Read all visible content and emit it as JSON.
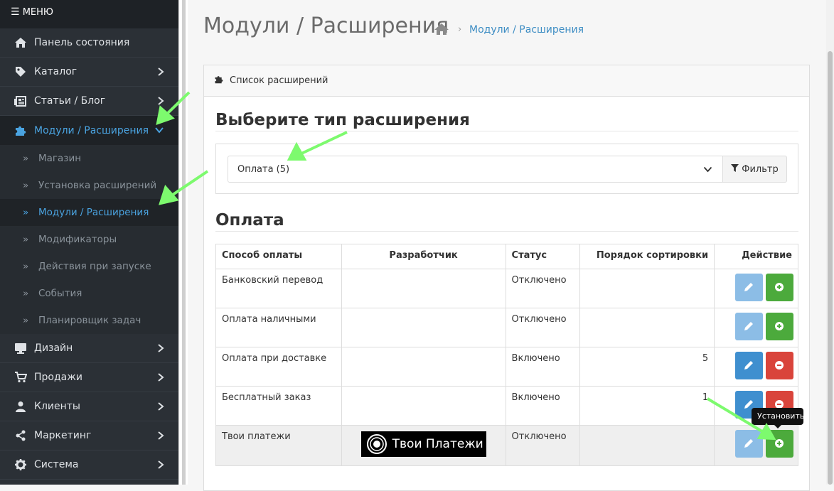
{
  "sidebar": {
    "menu_label": "МЕНЮ",
    "items": [
      {
        "label": "Панель состояния",
        "icon": "home-icon"
      },
      {
        "label": "Каталог",
        "icon": "tag-icon"
      },
      {
        "label": "Статьи / Блог",
        "icon": "newspaper-icon"
      },
      {
        "label": "Модули / Расширения",
        "icon": "puzzle-icon"
      },
      {
        "label": "Дизайн",
        "icon": "desktop-icon"
      },
      {
        "label": "Продажи",
        "icon": "cart-icon"
      },
      {
        "label": "Клиенты",
        "icon": "user-icon"
      },
      {
        "label": "Маркетинг",
        "icon": "share-icon"
      },
      {
        "label": "Система",
        "icon": "gear-icon"
      }
    ],
    "submenu": [
      {
        "label": "Магазин"
      },
      {
        "label": "Установка расширений"
      },
      {
        "label": "Модули / Расширения"
      },
      {
        "label": "Модификаторы"
      },
      {
        "label": "Действия при запуске"
      },
      {
        "label": "События"
      },
      {
        "label": "Планировщик задач"
      }
    ]
  },
  "header": {
    "title": "Модули / Расширения",
    "breadcrumb": "Модули / Расширения"
  },
  "panel": {
    "heading": "Список расширений",
    "choose_type": "Выберите тип расширения",
    "select_value": "Оплата (5)",
    "filter_label": "Фильтр",
    "section_title": "Оплата"
  },
  "table": {
    "columns": [
      "Способ оплаты",
      "Разработчик",
      "Статус",
      "Порядок сортировки",
      "Действие"
    ],
    "rows": [
      {
        "name": "Банковский перевод",
        "developer": "",
        "status": "Отключено",
        "sort": "",
        "action": "install"
      },
      {
        "name": "Оплата наличными",
        "developer": "",
        "status": "Отключено",
        "sort": "",
        "action": "install"
      },
      {
        "name": "Оплата при доставке",
        "developer": "",
        "status": "Включено",
        "sort": "5",
        "action": "uninstall"
      },
      {
        "name": "Бесплатный заказ",
        "developer": "",
        "status": "Включено",
        "sort": "1",
        "action": "uninstall"
      },
      {
        "name": "Твои платежи",
        "developer": "Твои Платежи",
        "status": "Отключено",
        "sort": "",
        "action": "install"
      }
    ]
  },
  "tooltip": "Установить",
  "colors": {
    "accent": "#3f8fcf",
    "install": "#4caa3c",
    "uninstall": "#d9443b",
    "sidebar": "#2b3036"
  }
}
